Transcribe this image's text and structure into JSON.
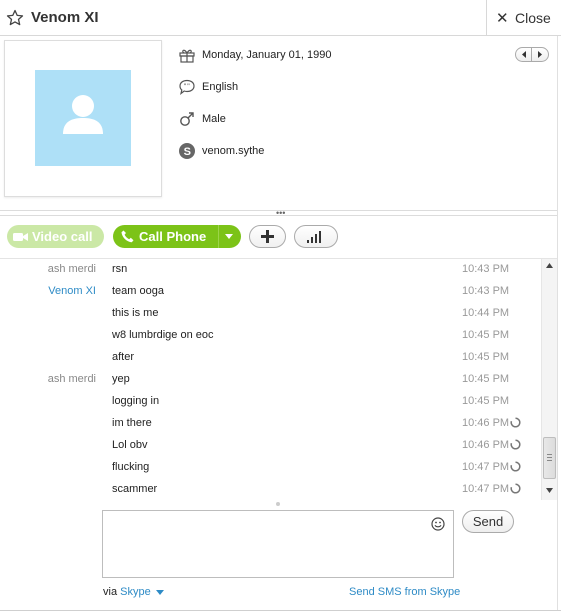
{
  "header": {
    "title": "Venom XI",
    "close_label": "Close",
    "close_glyph": "✕"
  },
  "profile": {
    "birthday": "Monday, January 01, 1990",
    "language": "English",
    "gender": "Male",
    "skype_name": "venom.sythe",
    "avatar_color": "#aee0f7"
  },
  "call_bar": {
    "video_label": "Video call",
    "call_label": "Call Phone",
    "accent_green": "#7cc318"
  },
  "messages": [
    {
      "sender": "ash merdi",
      "text": "rsn",
      "time": "10:43 PM",
      "pending": false,
      "sender_color": "#888888"
    },
    {
      "sender": "Venom XI",
      "text": "team ooga",
      "time": "10:43 PM",
      "pending": false,
      "sender_color": "#2e8bc6"
    },
    {
      "sender": "",
      "text": "this is me",
      "time": "10:44 PM",
      "pending": false
    },
    {
      "sender": "",
      "text": "w8 lumbrdige on eoc",
      "time": "10:45 PM",
      "pending": false
    },
    {
      "sender": "",
      "text": "after",
      "time": "10:45 PM",
      "pending": false
    },
    {
      "sender": "ash merdi",
      "text": "yep",
      "time": "10:45 PM",
      "pending": false,
      "sender_color": "#888888"
    },
    {
      "sender": "",
      "text": "logging in",
      "time": "10:45 PM",
      "pending": false
    },
    {
      "sender": "",
      "text": "im there",
      "time": "10:46 PM",
      "pending": true
    },
    {
      "sender": "",
      "text": "Lol obv",
      "time": "10:46 PM",
      "pending": true
    },
    {
      "sender": "",
      "text": "flucking",
      "time": "10:47 PM",
      "pending": true
    },
    {
      "sender": "",
      "text": "scammer",
      "time": "10:47 PM",
      "pending": true
    }
  ],
  "compose": {
    "send_label": "Send",
    "via_prefix": "via",
    "via_link": "Skype",
    "sms_link": "Send SMS from Skype"
  },
  "icons": {
    "header_star": "star-icon",
    "birthday": "gift-icon",
    "language": "speech-bubble-icon",
    "gender": "male-symbol-icon",
    "skype": "skype-icon",
    "video": "video-camera-icon",
    "call": "phone-icon",
    "add": "plus-icon",
    "signal": "signal-bars-icon",
    "emoji": "smiley-icon",
    "pending": "spinner-icon"
  }
}
